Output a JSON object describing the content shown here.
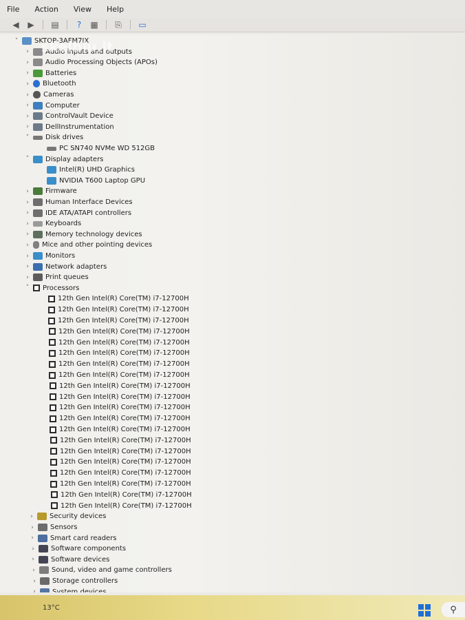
{
  "menu": [
    "File",
    "Action",
    "View",
    "Help"
  ],
  "toolbar_icons": [
    "back-icon",
    "forward-icon",
    "properties-icon",
    "help-icon",
    "view-icon",
    "scan-icon",
    "monitor-icon"
  ],
  "tree": {
    "root": "SKTOP-3AFM7IX",
    "watermark": "skelbiu.lt",
    "categories_top": [
      {
        "label": "Audio inputs and outputs",
        "icon": "audio"
      },
      {
        "label": "Audio Processing Objects (APOs)",
        "icon": "audio"
      },
      {
        "label": "Batteries",
        "icon": "battery"
      },
      {
        "label": "Bluetooth",
        "icon": "bt"
      },
      {
        "label": "Cameras",
        "icon": "cam"
      },
      {
        "label": "Computer",
        "icon": "monitor"
      },
      {
        "label": "ControlVault Device",
        "icon": "gear"
      },
      {
        "label": "DellInstrumentation",
        "icon": "gear"
      }
    ],
    "disk_drives": {
      "label": "Disk drives",
      "children": [
        "PC SN740 NVMe WD 512GB"
      ]
    },
    "display_adapters": {
      "label": "Display adapters",
      "children": [
        "Intel(R) UHD Graphics",
        "NVIDIA T600 Laptop GPU"
      ]
    },
    "categories_mid": [
      {
        "label": "Firmware",
        "icon": "firm"
      },
      {
        "label": "Human Interface Devices",
        "icon": "hid"
      },
      {
        "label": "IDE ATA/ATAPI controllers",
        "icon": "hid"
      },
      {
        "label": "Keyboards",
        "icon": "kbd"
      },
      {
        "label": "Memory technology devices",
        "icon": "mem"
      },
      {
        "label": "Mice and other pointing devices",
        "icon": "mouse"
      },
      {
        "label": "Monitors",
        "icon": "display"
      },
      {
        "label": "Network adapters",
        "icon": "net"
      },
      {
        "label": "Print queues",
        "icon": "print"
      }
    ],
    "processors": {
      "label": "Processors",
      "children": [
        "12th Gen Intel(R) Core(TM) i7-12700H",
        "12th Gen Intel(R) Core(TM) i7-12700H",
        "12th Gen Intel(R) Core(TM) i7-12700H",
        "12th Gen Intel(R) Core(TM) i7-12700H",
        "12th Gen Intel(R) Core(TM) i7-12700H",
        "12th Gen Intel(R) Core(TM) i7-12700H",
        "12th Gen Intel(R) Core(TM) i7-12700H",
        "12th Gen Intel(R) Core(TM) i7-12700H",
        "12th Gen Intel(R) Core(TM) i7-12700H",
        "12th Gen Intel(R) Core(TM) i7-12700H",
        "12th Gen Intel(R) Core(TM) i7-12700H",
        "12th Gen Intel(R) Core(TM) i7-12700H",
        "12th Gen Intel(R) Core(TM) i7-12700H",
        "12th Gen Intel(R) Core(TM) i7-12700H",
        "12th Gen Intel(R) Core(TM) i7-12700H",
        "12th Gen Intel(R) Core(TM) i7-12700H",
        "12th Gen Intel(R) Core(TM) i7-12700H",
        "12th Gen Intel(R) Core(TM) i7-12700H",
        "12th Gen Intel(R) Core(TM) i7-12700H",
        "12th Gen Intel(R) Core(TM) i7-12700H"
      ]
    },
    "categories_bottom": [
      {
        "label": "Security devices",
        "icon": "sec"
      },
      {
        "label": "Sensors",
        "icon": "sensor"
      },
      {
        "label": "Smart card readers",
        "icon": "smart"
      },
      {
        "label": "Software components",
        "icon": "soft"
      },
      {
        "label": "Software devices",
        "icon": "soft"
      },
      {
        "label": "Sound, video and game controllers",
        "icon": "sound"
      },
      {
        "label": "Storage controllers",
        "icon": "storage"
      },
      {
        "label": "System devices",
        "icon": "system"
      }
    ]
  },
  "taskbar": {
    "weather": "13°C"
  }
}
